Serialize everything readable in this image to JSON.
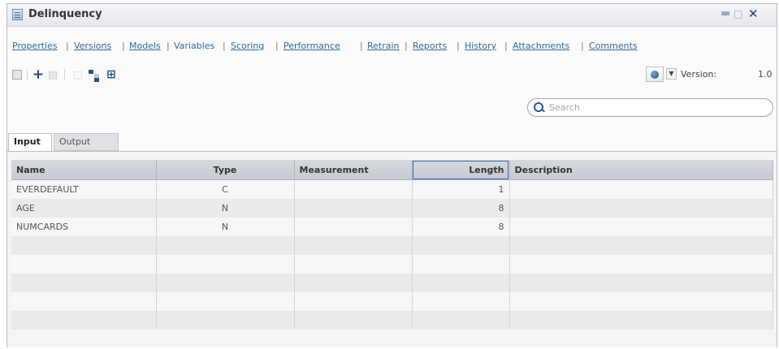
{
  "window": {
    "title": "Delinquency",
    "icon": "document-icon",
    "controls": {
      "minimize": "minimize-icon",
      "maximize": "maximize-icon",
      "close": "close-icon"
    }
  },
  "nav_tabs": [
    {
      "label": "Properties",
      "active": false
    },
    {
      "label": "Versions",
      "active": false
    },
    {
      "label": "Models",
      "active": false
    },
    {
      "label": "Variables",
      "active": true
    },
    {
      "label": "Scoring",
      "active": false
    },
    {
      "label": "Performance",
      "active": false
    },
    {
      "label": "Retrain",
      "active": false
    },
    {
      "label": "Reports",
      "active": false
    },
    {
      "label": "History",
      "active": false
    },
    {
      "label": "Attachments",
      "active": false
    },
    {
      "label": "Comments",
      "active": false
    }
  ],
  "toolbar": {
    "items": [
      "save-icon",
      "add-icon",
      "delete-icon",
      "select-icon",
      "tree-icon",
      "map-icon"
    ],
    "version_label": "Version:",
    "version_value": "1.0"
  },
  "search": {
    "placeholder": "Search"
  },
  "sub_tabs": [
    {
      "label": "Input",
      "active": true
    },
    {
      "label": "Output",
      "active": false
    }
  ],
  "table": {
    "columns": [
      "Name",
      "Type",
      "Measurement",
      "Length",
      "Description"
    ],
    "rows": [
      [
        "EVERDEFAULT",
        "C",
        "",
        "1",
        ""
      ],
      [
        "AGE",
        "N",
        "",
        "8",
        ""
      ],
      [
        "NUMCARDS",
        "N",
        "",
        "8",
        ""
      ],
      [
        "",
        "",
        "",
        "",
        ""
      ],
      [
        "",
        "",
        "",
        "",
        ""
      ],
      [
        "",
        "",
        "",
        "",
        ""
      ],
      [
        "",
        "",
        "",
        "",
        ""
      ],
      [
        "",
        "",
        "",
        "",
        ""
      ]
    ]
  },
  "colors": {
    "link": "#336699",
    "header_bg": "#c7cad0",
    "accent": "#1f4a8a"
  }
}
